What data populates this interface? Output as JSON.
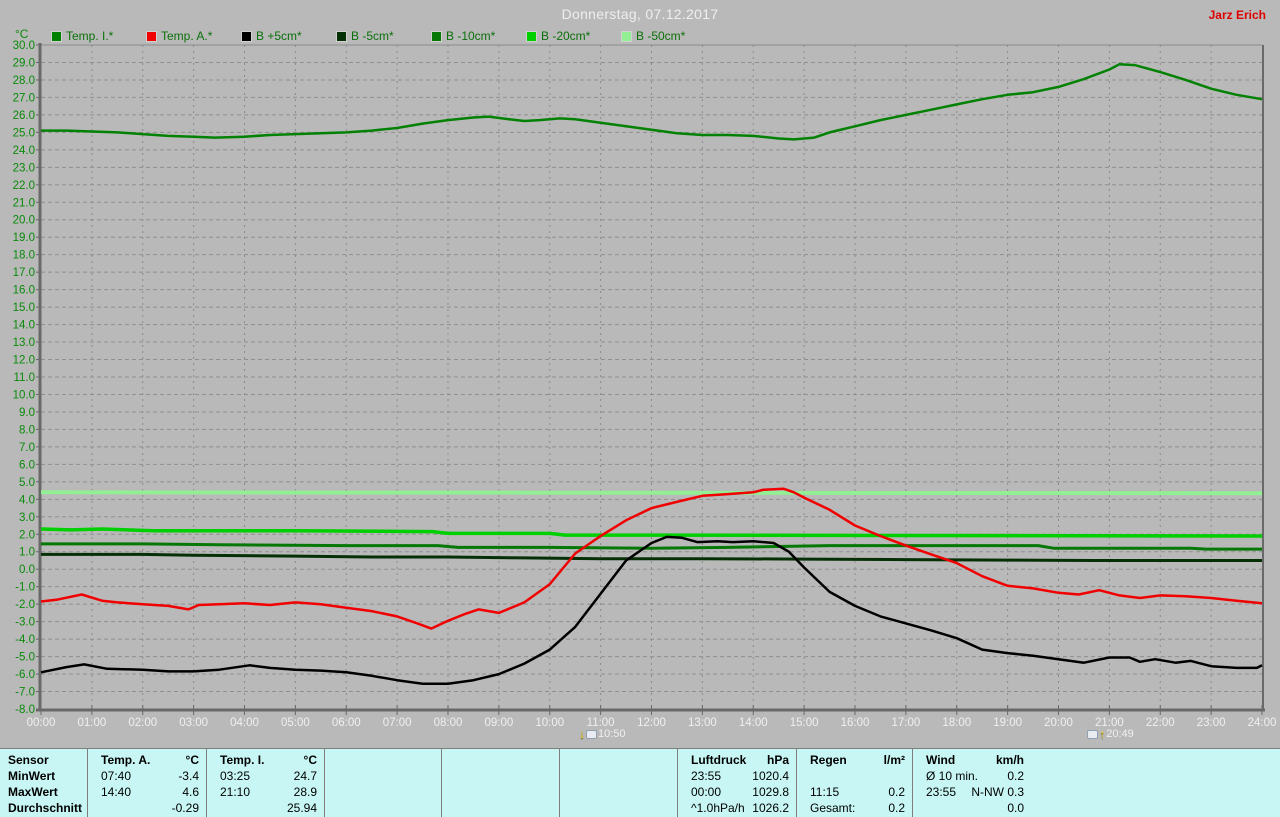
{
  "header": {
    "title": "Donnerstag, 07.12.2017",
    "author": "Jarz Erich",
    "unit_label": "°C"
  },
  "legend": [
    {
      "label": "Temp. I.*",
      "color": "#038103"
    },
    {
      "label": "Temp. A.*",
      "color": "#f00000"
    },
    {
      "label": "B +5cm*",
      "color": "#000000"
    },
    {
      "label": "B -5cm*",
      "color": "#053005"
    },
    {
      "label": "B -10cm*",
      "color": "#067806"
    },
    {
      "label": "B -20cm*",
      "color": "#00cf00"
    },
    {
      "label": "B -50cm*",
      "color": "#93ef93"
    }
  ],
  "colors": {
    "background": "#b9b9b9",
    "table_background": "#c7f6f4",
    "axis_label_green": "#0a8a0a",
    "x_label_white": "#f0f0f0",
    "author_red": "#dd0000",
    "grid_gray": "#8f8f8f",
    "axis_border": "#696969"
  },
  "chart_data": {
    "type": "line",
    "title": "Donnerstag, 07.12.2017",
    "ylabel": "°C",
    "ylim": [
      -8.0,
      30.0
    ],
    "y_step": 1.0,
    "xlim_hours": [
      0,
      24
    ],
    "grid": true,
    "legend_position": "top",
    "x_tick_labels": [
      "00:00",
      "01:00",
      "02:00",
      "03:00",
      "04:00",
      "05:00",
      "06:00",
      "07:00",
      "08:00",
      "09:00",
      "10:00",
      "11:00",
      "12:00",
      "13:00",
      "14:00",
      "15:00",
      "16:00",
      "17:00",
      "18:00",
      "19:00",
      "20:00",
      "21:00",
      "22:00",
      "23:00",
      "24:00"
    ],
    "markers": [
      {
        "label": "10:50",
        "hour": 10.83,
        "direction": "down"
      },
      {
        "label": "20:49",
        "hour": 20.82,
        "direction": "up"
      }
    ],
    "series": [
      {
        "name": "B -50cm*",
        "color": "#93ef93",
        "width": 4,
        "points": [
          [
            0,
            4.4
          ],
          [
            10,
            4.38
          ],
          [
            24,
            4.35
          ]
        ]
      },
      {
        "name": "B -5cm*",
        "color": "#053005",
        "width": 3,
        "points": [
          [
            0,
            0.85
          ],
          [
            2,
            0.85
          ],
          [
            3,
            0.8
          ],
          [
            5,
            0.75
          ],
          [
            6.5,
            0.7
          ],
          [
            8,
            0.7
          ],
          [
            9.5,
            0.65
          ],
          [
            11,
            0.6
          ],
          [
            13,
            0.6
          ],
          [
            15,
            0.58
          ],
          [
            17,
            0.55
          ],
          [
            19,
            0.52
          ],
          [
            20.7,
            0.5
          ],
          [
            24,
            0.5
          ]
        ]
      },
      {
        "name": "B -10cm*",
        "color": "#067806",
        "width": 3,
        "points": [
          [
            0,
            1.45
          ],
          [
            2,
            1.45
          ],
          [
            3.5,
            1.4
          ],
          [
            6,
            1.35
          ],
          [
            7.8,
            1.35
          ],
          [
            8.2,
            1.25
          ],
          [
            10,
            1.25
          ],
          [
            12,
            1.2
          ],
          [
            13.5,
            1.25
          ],
          [
            15.5,
            1.35
          ],
          [
            19.6,
            1.35
          ],
          [
            19.9,
            1.2
          ],
          [
            22.6,
            1.2
          ],
          [
            22.9,
            1.15
          ],
          [
            24,
            1.15
          ]
        ]
      },
      {
        "name": "B -20cm*",
        "color": "#00cf00",
        "width": 3.5,
        "points": [
          [
            0,
            2.3
          ],
          [
            0.6,
            2.25
          ],
          [
            1.2,
            2.3
          ],
          [
            2.2,
            2.2
          ],
          [
            5,
            2.2
          ],
          [
            7.7,
            2.15
          ],
          [
            8,
            2.05
          ],
          [
            10,
            2.05
          ],
          [
            10.3,
            1.95
          ],
          [
            12,
            1.95
          ],
          [
            24,
            1.9
          ]
        ]
      },
      {
        "name": "Temp. I.*",
        "color": "#038103",
        "width": 2.5,
        "points": [
          [
            0,
            25.1
          ],
          [
            0.5,
            25.1
          ],
          [
            1,
            25.05
          ],
          [
            1.5,
            25.0
          ],
          [
            2,
            24.9
          ],
          [
            2.5,
            24.8
          ],
          [
            3,
            24.75
          ],
          [
            3.42,
            24.7
          ],
          [
            4,
            24.75
          ],
          [
            4.5,
            24.85
          ],
          [
            5,
            24.9
          ],
          [
            5.5,
            24.95
          ],
          [
            6,
            25.0
          ],
          [
            6.5,
            25.1
          ],
          [
            7,
            25.25
          ],
          [
            7.5,
            25.5
          ],
          [
            8,
            25.7
          ],
          [
            8.5,
            25.85
          ],
          [
            8.8,
            25.9
          ],
          [
            9.2,
            25.75
          ],
          [
            9.5,
            25.65
          ],
          [
            9.8,
            25.7
          ],
          [
            10.2,
            25.8
          ],
          [
            10.5,
            25.75
          ],
          [
            11,
            25.55
          ],
          [
            11.5,
            25.35
          ],
          [
            12,
            25.15
          ],
          [
            12.5,
            24.95
          ],
          [
            13,
            24.85
          ],
          [
            13.5,
            24.85
          ],
          [
            14,
            24.8
          ],
          [
            14.5,
            24.65
          ],
          [
            14.8,
            24.6
          ],
          [
            15.2,
            24.7
          ],
          [
            15.5,
            25.0
          ],
          [
            16,
            25.35
          ],
          [
            16.5,
            25.7
          ],
          [
            17,
            26.0
          ],
          [
            17.5,
            26.3
          ],
          [
            18,
            26.6
          ],
          [
            18.5,
            26.9
          ],
          [
            19,
            27.15
          ],
          [
            19.5,
            27.3
          ],
          [
            20,
            27.6
          ],
          [
            20.5,
            28.05
          ],
          [
            21,
            28.6
          ],
          [
            21.2,
            28.9
          ],
          [
            21.5,
            28.85
          ],
          [
            22,
            28.45
          ],
          [
            22.5,
            28.0
          ],
          [
            23,
            27.5
          ],
          [
            23.5,
            27.15
          ],
          [
            24,
            26.9
          ]
        ]
      },
      {
        "name": "B +5cm*",
        "color": "#000000",
        "width": 2.5,
        "points": [
          [
            0,
            -5.9
          ],
          [
            0.5,
            -5.6
          ],
          [
            0.85,
            -5.45
          ],
          [
            1.3,
            -5.7
          ],
          [
            2,
            -5.75
          ],
          [
            2.5,
            -5.85
          ],
          [
            3,
            -5.85
          ],
          [
            3.5,
            -5.75
          ],
          [
            4.1,
            -5.5
          ],
          [
            4.5,
            -5.65
          ],
          [
            5,
            -5.75
          ],
          [
            5.5,
            -5.8
          ],
          [
            6,
            -5.9
          ],
          [
            6.5,
            -6.1
          ],
          [
            7,
            -6.35
          ],
          [
            7.5,
            -6.55
          ],
          [
            8,
            -6.55
          ],
          [
            8.5,
            -6.35
          ],
          [
            9,
            -6.0
          ],
          [
            9.5,
            -5.4
          ],
          [
            10,
            -4.6
          ],
          [
            10.5,
            -3.3
          ],
          [
            11,
            -1.4
          ],
          [
            11.5,
            0.5
          ],
          [
            12,
            1.5
          ],
          [
            12.3,
            1.85
          ],
          [
            12.6,
            1.8
          ],
          [
            12.9,
            1.55
          ],
          [
            13.3,
            1.6
          ],
          [
            13.6,
            1.55
          ],
          [
            14,
            1.6
          ],
          [
            14.4,
            1.5
          ],
          [
            14.7,
            1.0
          ],
          [
            15,
            0.1
          ],
          [
            15.5,
            -1.3
          ],
          [
            16,
            -2.1
          ],
          [
            16.5,
            -2.7
          ],
          [
            17,
            -3.1
          ],
          [
            17.5,
            -3.5
          ],
          [
            18,
            -3.95
          ],
          [
            18.5,
            -4.6
          ],
          [
            19,
            -4.8
          ],
          [
            19.5,
            -4.95
          ],
          [
            20,
            -5.15
          ],
          [
            20.5,
            -5.35
          ],
          [
            21,
            -5.05
          ],
          [
            21.4,
            -5.05
          ],
          [
            21.6,
            -5.3
          ],
          [
            21.9,
            -5.15
          ],
          [
            22.3,
            -5.35
          ],
          [
            22.6,
            -5.25
          ],
          [
            23,
            -5.55
          ],
          [
            23.5,
            -5.65
          ],
          [
            23.9,
            -5.65
          ],
          [
            24,
            -5.5
          ]
        ]
      },
      {
        "name": "Temp. A.*",
        "color": "#f00000",
        "width": 2.5,
        "points": [
          [
            0,
            -1.85
          ],
          [
            0.3,
            -1.75
          ],
          [
            0.8,
            -1.45
          ],
          [
            1.2,
            -1.8
          ],
          [
            1.5,
            -1.9
          ],
          [
            2,
            -2.0
          ],
          [
            2.5,
            -2.1
          ],
          [
            2.9,
            -2.3
          ],
          [
            3.1,
            -2.05
          ],
          [
            3.5,
            -2.0
          ],
          [
            4,
            -1.95
          ],
          [
            4.5,
            -2.05
          ],
          [
            5,
            -1.9
          ],
          [
            5.5,
            -2.0
          ],
          [
            6,
            -2.2
          ],
          [
            6.5,
            -2.4
          ],
          [
            7,
            -2.7
          ],
          [
            7.4,
            -3.1
          ],
          [
            7.67,
            -3.4
          ],
          [
            8,
            -2.95
          ],
          [
            8.3,
            -2.6
          ],
          [
            8.6,
            -2.3
          ],
          [
            9,
            -2.5
          ],
          [
            9.5,
            -1.9
          ],
          [
            10,
            -0.85
          ],
          [
            10.5,
            0.9
          ],
          [
            11,
            1.9
          ],
          [
            11.5,
            2.8
          ],
          [
            12,
            3.5
          ],
          [
            12.5,
            3.85
          ],
          [
            13,
            4.2
          ],
          [
            13.5,
            4.3
          ],
          [
            14,
            4.4
          ],
          [
            14.2,
            4.55
          ],
          [
            14.6,
            4.6
          ],
          [
            14.8,
            4.4
          ],
          [
            15,
            4.1
          ],
          [
            15.5,
            3.4
          ],
          [
            16,
            2.5
          ],
          [
            16.5,
            1.9
          ],
          [
            17,
            1.35
          ],
          [
            17.5,
            0.85
          ],
          [
            18,
            0.35
          ],
          [
            18.5,
            -0.4
          ],
          [
            19,
            -0.95
          ],
          [
            19.5,
            -1.1
          ],
          [
            20,
            -1.35
          ],
          [
            20.4,
            -1.45
          ],
          [
            20.8,
            -1.2
          ],
          [
            21.2,
            -1.5
          ],
          [
            21.6,
            -1.65
          ],
          [
            22,
            -1.5
          ],
          [
            22.5,
            -1.55
          ],
          [
            23,
            -1.65
          ],
          [
            23.5,
            -1.8
          ],
          [
            24,
            -1.95
          ]
        ]
      }
    ]
  },
  "table": {
    "row_labels": [
      "Sensor",
      "MinWert",
      "MaxWert",
      "Durchschnitt"
    ],
    "columns": [
      {
        "name": "Temp. A.",
        "unit": "°C",
        "rows": [
          [
            "07:40",
            "-3.4"
          ],
          [
            "14:40",
            "4.6"
          ],
          [
            "",
            "-0.29"
          ]
        ]
      },
      {
        "name": "Temp. I.",
        "unit": "°C",
        "rows": [
          [
            "03:25",
            "24.7"
          ],
          [
            "21:10",
            "28.9"
          ],
          [
            "",
            "25.94"
          ]
        ]
      },
      {
        "name": "",
        "unit": "",
        "rows": [
          [
            "",
            ""
          ],
          [
            "",
            ""
          ],
          [
            "",
            ""
          ]
        ]
      },
      {
        "name": "",
        "unit": "",
        "rows": [
          [
            "",
            ""
          ],
          [
            "",
            ""
          ],
          [
            "",
            ""
          ]
        ]
      },
      {
        "name": "",
        "unit": "",
        "rows": [
          [
            "",
            ""
          ],
          [
            "",
            ""
          ],
          [
            "",
            ""
          ]
        ]
      },
      {
        "name": "Luftdruck",
        "unit": "hPa",
        "rows": [
          [
            "23:55",
            "1020.4"
          ],
          [
            "00:00",
            "1029.8"
          ],
          [
            "^1.0hPa/h",
            "1026.2"
          ]
        ]
      },
      {
        "name": "Regen",
        "unit": "l/m²",
        "rows": [
          [
            "",
            ""
          ],
          [
            "11:15",
            "0.2"
          ],
          [
            "Gesamt:",
            "0.2"
          ]
        ]
      },
      {
        "name": "Wind",
        "unit": "km/h",
        "rows": [
          [
            "Ø 10 min.",
            "0.2"
          ],
          [
            "23:55",
            "N-NW 0.3"
          ],
          [
            "",
            "0.0"
          ]
        ]
      }
    ]
  }
}
